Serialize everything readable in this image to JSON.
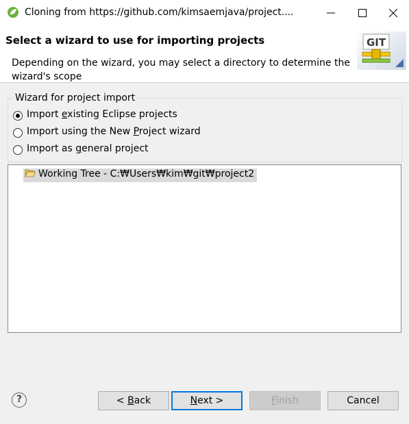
{
  "window": {
    "title": "Cloning from https://github.com/kimsaemjava/project...."
  },
  "header": {
    "wizard_title": "Select a wizard to use for importing projects",
    "description": "Depending on the wizard, you may select a directory to determine the wizard's scope",
    "banner_text": "GIT"
  },
  "group": {
    "legend": "Wizard for project import",
    "options": [
      {
        "pre": "Import ",
        "mn": "e",
        "post": "xisting Eclipse projects",
        "checked": true
      },
      {
        "pre": "Import using the New ",
        "mn": "P",
        "post": "roject wizard",
        "checked": false
      },
      {
        "pre": "Import as ",
        "mn": "g",
        "post": "eneral project",
        "checked": false
      }
    ]
  },
  "tree": {
    "items": [
      {
        "label": "Working Tree - C:₩Users₩kim₩git₩project2",
        "icon": "folder-open-icon"
      }
    ]
  },
  "buttons": {
    "help": "?",
    "back": {
      "pre": "< ",
      "mn": "B",
      "post": "ack"
    },
    "next": {
      "pre": "",
      "mn": "N",
      "post": "ext >"
    },
    "finish": {
      "pre": "",
      "mn": "F",
      "post": "inish"
    },
    "cancel": "Cancel"
  },
  "colors": {
    "accent": "#0078d7",
    "selection": "#dadada"
  }
}
